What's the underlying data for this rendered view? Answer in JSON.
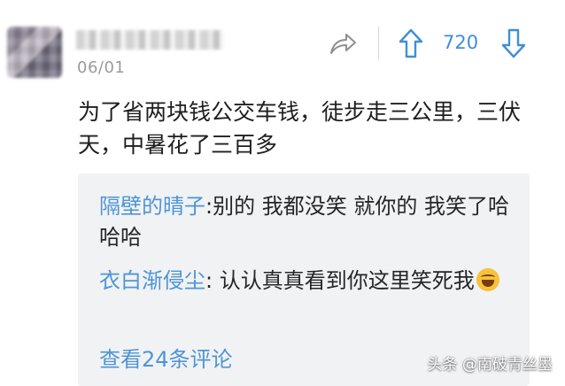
{
  "post": {
    "date": "06/01",
    "vote_count": "720",
    "content": "为了省两块钱公交车钱，徒步走三公里，三伏天，中暑花了三百多"
  },
  "replies": [
    {
      "name": "隔壁的晴子",
      "text": ":别的  我都没笑  就你的 我笑了哈哈哈"
    },
    {
      "name": "衣白渐侵尘",
      "text": ": 认认真真看到你这里笑死我",
      "emoji": "laughing-tears-emoji"
    }
  ],
  "view_all_label": "查看24条评论",
  "watermark": "头条 @南破青丝墨",
  "colors": {
    "accent": "#4e95d6",
    "reply_bg": "#f1f2f4",
    "meta": "#9a9a9a"
  }
}
